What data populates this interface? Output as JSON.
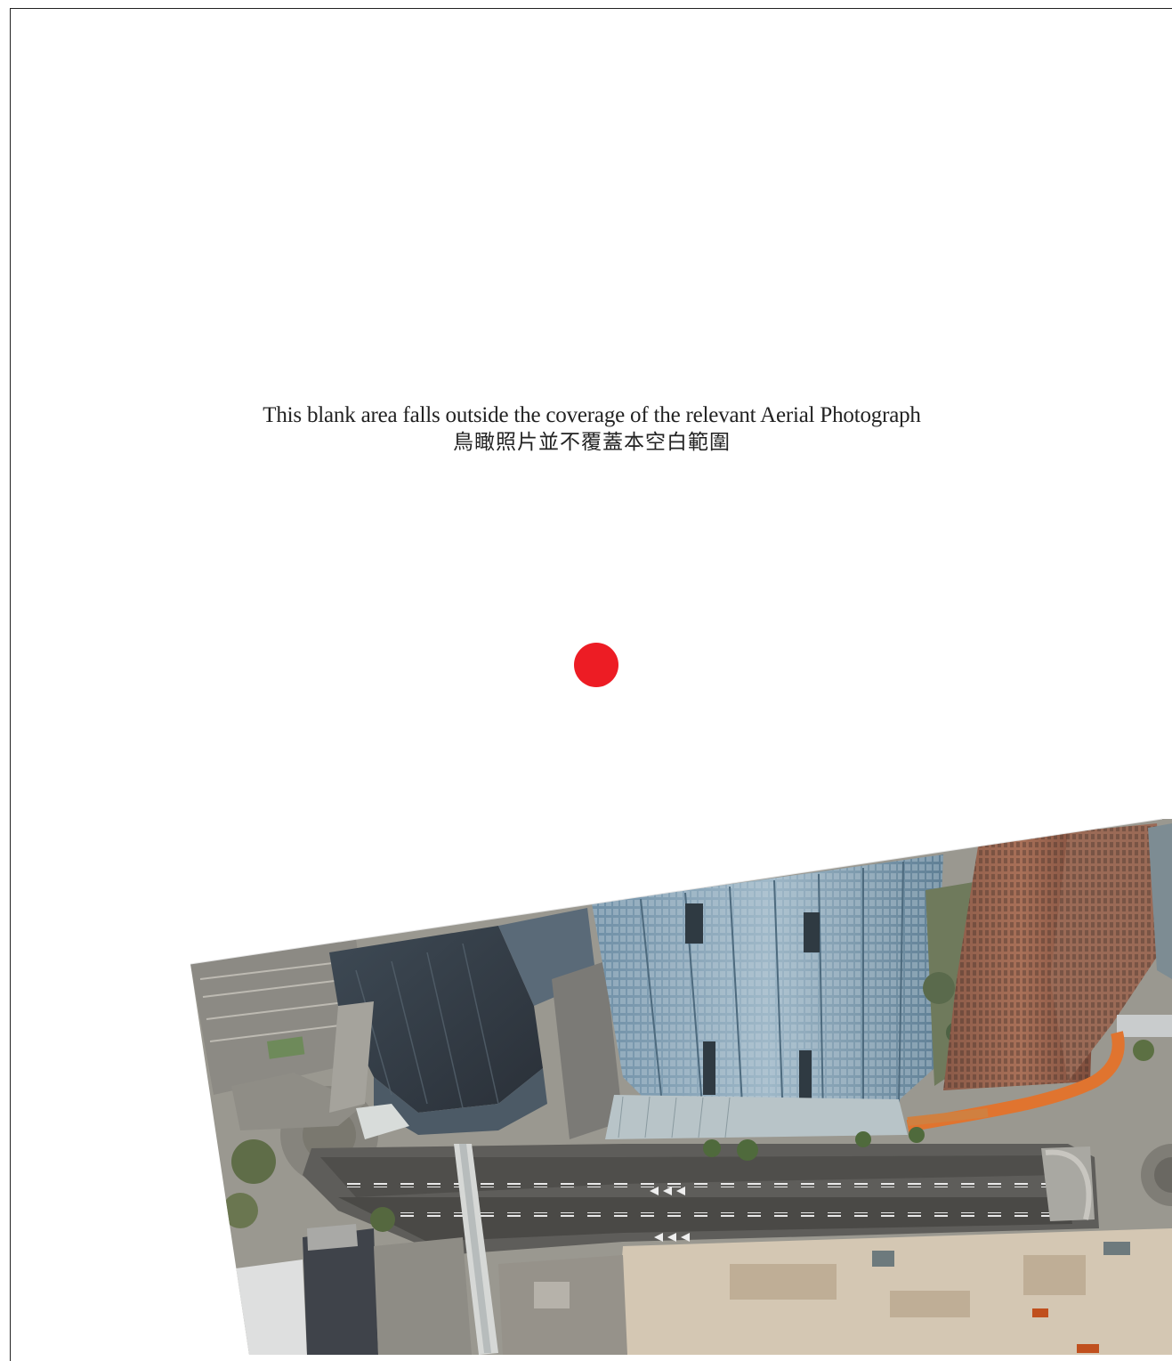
{
  "notice": {
    "english": "This blank area falls outside the coverage of the relevant Aerial Photograph",
    "chinese": "鳥瞰照片並不覆蓋本空白範圍"
  },
  "marker": {
    "color": "#ED1C24",
    "icon": "location-dot-icon"
  }
}
